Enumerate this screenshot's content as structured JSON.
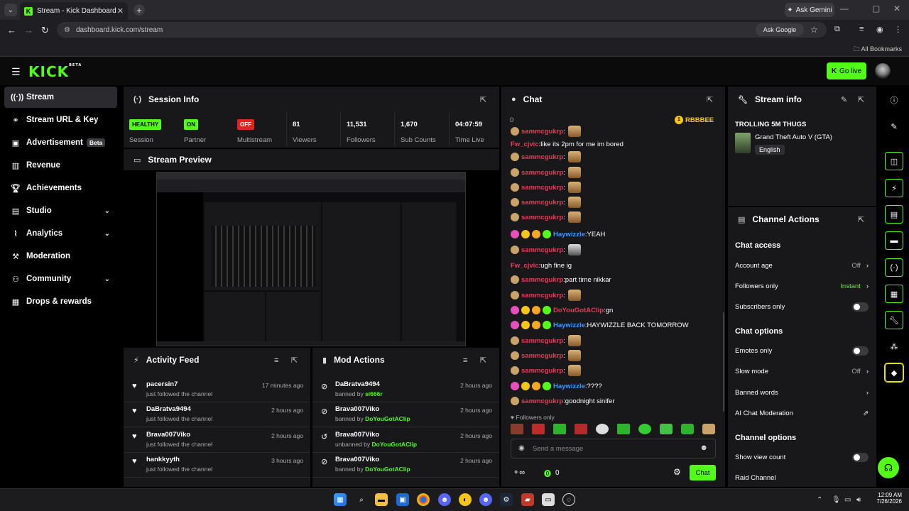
{
  "browser": {
    "tab_title": "Stream - Kick Dashboard",
    "ask_gemini": "Ask Gemini",
    "url": "dashboard.kick.com/stream",
    "ask_google": "Ask Google",
    "all_bookmarks": "All Bookmarks"
  },
  "header": {
    "logo": "KICK",
    "logo_beta": "BETA",
    "go_live": "Go live"
  },
  "sidebar": {
    "items": [
      {
        "label": "Stream",
        "icon": "broadcast-icon"
      },
      {
        "label": "Stream URL & Key",
        "icon": "link-icon"
      },
      {
        "label": "Advertisement",
        "icon": "ad-icon",
        "badge": "Beta"
      },
      {
        "label": "Revenue",
        "icon": "bars-icon"
      },
      {
        "label": "Achievements",
        "icon": "trophy-icon"
      },
      {
        "label": "Studio",
        "icon": "studio-icon"
      },
      {
        "label": "Analytics",
        "icon": "analytics-icon"
      },
      {
        "label": "Moderation",
        "icon": "hammer-icon"
      },
      {
        "label": "Community",
        "icon": "community-icon"
      },
      {
        "label": "Drops & rewards",
        "icon": "gift-icon"
      }
    ]
  },
  "session": {
    "title": "Session Info",
    "stats": [
      {
        "badge": "HEALTHY",
        "label": "Session"
      },
      {
        "badge": "ON",
        "label": "Partner"
      },
      {
        "badge": "OFF",
        "label": "Multistream"
      },
      {
        "value": "81",
        "label": "Viewers"
      },
      {
        "value": "11,531",
        "label": "Followers"
      },
      {
        "value": "1,670",
        "label": "Sub Counts"
      },
      {
        "value": "04:07:59",
        "label": "Time Live"
      }
    ]
  },
  "preview": {
    "title": "Stream Preview"
  },
  "activity": {
    "title": "Activity Feed",
    "rows": [
      {
        "name": "pacersin7",
        "action": "just followed the channel",
        "time": "17 minutes ago"
      },
      {
        "name": "DaBratva9494",
        "action": "just followed the channel",
        "time": "2 hours ago"
      },
      {
        "name": "Brava007Viko",
        "action": "just followed the channel",
        "time": "2 hours ago"
      },
      {
        "name": "hankkyyth",
        "action": "just followed the channel",
        "time": "3 hours ago"
      }
    ]
  },
  "mod": {
    "title": "Mod Actions",
    "rows": [
      {
        "name": "DaBratva9494",
        "action": "banned by",
        "by": "si666r",
        "time": "2 hours ago"
      },
      {
        "name": "Brava007Viko",
        "action": "banned by",
        "by": "DoYouGotAClip",
        "time": "2 hours ago"
      },
      {
        "name": "Brava007Viko",
        "action": "unbanned by",
        "by": "DoYouGotAClip",
        "time": "2 hours ago"
      },
      {
        "name": "Brava007Viko",
        "action": "banned by",
        "by": "DoYouGotAClip",
        "time": "2 hours ago"
      }
    ]
  },
  "chat": {
    "title": "Chat",
    "count": "0",
    "pinned_user": "RBBBEE",
    "messages": [
      {
        "user": "sammcgukrp",
        "text": "",
        "color": "#e83c5a",
        "emote": true
      },
      {
        "user": "Fw_cjvic",
        "text": "like its 2pm for me im bored",
        "color": "#e83c5a"
      },
      {
        "user": "sammcgukrp",
        "text": "",
        "color": "#e83c5a",
        "emote": true
      },
      {
        "user": "sammcgukrp",
        "text": "",
        "color": "#e83c5a",
        "emote": true
      },
      {
        "user": "sammcgukrp",
        "text": "",
        "color": "#e83c5a",
        "emote": true
      },
      {
        "user": "sammcgukrp",
        "text": "",
        "color": "#e83c5a",
        "emote": true
      },
      {
        "user": "sammcgukrp",
        "text": "",
        "color": "#e83c5a",
        "emote": true
      },
      {
        "user": "Haywizzle",
        "text": "YEAH",
        "color": "#3d9bff"
      },
      {
        "user": "sammcgukrp",
        "text": "",
        "color": "#e83c5a",
        "emote": true
      },
      {
        "user": "Fw_cjvic",
        "text": "ugh fine ig",
        "color": "#e83c5a"
      },
      {
        "user": "sammcgukrp",
        "text": "part time nikkar",
        "color": "#e83c5a"
      },
      {
        "user": "sammcgukrp",
        "text": "",
        "color": "#e83c5a",
        "emote": true
      },
      {
        "user": "DoYouGotAClip",
        "text": "gn",
        "color": "#e83c5a"
      },
      {
        "user": "Haywizzle",
        "text": "HAYWIZZLE BACK TOMORROW",
        "color": "#3d9bff"
      },
      {
        "user": "sammcgukrp",
        "text": "",
        "color": "#e83c5a",
        "emote": true
      },
      {
        "user": "sammcgukrp",
        "text": "",
        "color": "#e83c5a",
        "emote": true
      },
      {
        "user": "sammcgukrp",
        "text": "",
        "color": "#e83c5a",
        "emote": true
      },
      {
        "user": "Haywizzle",
        "text": "????",
        "color": "#3d9bff"
      },
      {
        "user": "sammcgukrp",
        "text": "goodnight sinifer",
        "color": "#e83c5a"
      }
    ],
    "followers_only": "Followers only",
    "placeholder": "Send a message",
    "points": "0",
    "send": "Chat"
  },
  "stream_info": {
    "title": "Stream info",
    "stream_title": "TROLLING 5M THUGS",
    "category": "Grand Theft Auto V (GTA)",
    "language": "English"
  },
  "channel_actions": {
    "title": "Channel Actions",
    "chat_access": "Chat access",
    "account_age": "Account age",
    "account_age_val": "Off",
    "followers_only": "Followers only",
    "followers_only_val": "Instant",
    "subscribers_only": "Subscribers only",
    "chat_options": "Chat options",
    "emotes_only": "Emotes only",
    "slow_mode": "Slow mode",
    "slow_mode_val": "Off",
    "banned_words": "Banned words",
    "ai_moderation": "AI Chat Moderation",
    "channel_options": "Channel options",
    "show_view_count": "Show view count",
    "raid": "Raid Channel"
  },
  "taskbar": {
    "time": "12:09 AM",
    "date": "7/26/2026"
  }
}
